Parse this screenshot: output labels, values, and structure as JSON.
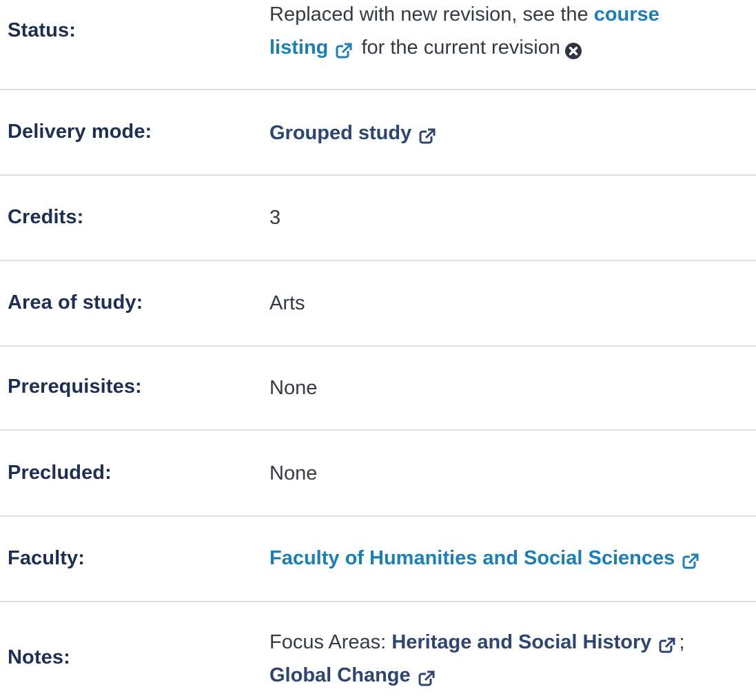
{
  "rows": {
    "status": {
      "label": "Status:",
      "text_before": "Replaced with new revision, see the",
      "link_line1": "course",
      "link_line2": "listing",
      "text_after": "for the current revision"
    },
    "delivery": {
      "label": "Delivery mode:",
      "link": "Grouped study"
    },
    "credits": {
      "label": "Credits:",
      "value": "3"
    },
    "area": {
      "label": "Area of study:",
      "value": "Arts"
    },
    "prereq": {
      "label": "Prerequisites:",
      "value": "None"
    },
    "precluded": {
      "label": "Precluded:",
      "value": "None"
    },
    "faculty": {
      "label": "Faculty:",
      "link": "Faculty of Humanities and Social Sciences"
    },
    "notes": {
      "label": "Notes:",
      "prefix": "Focus Areas:",
      "link1": "Heritage and Social History",
      "separator": ";",
      "link2": "Global Change"
    }
  },
  "colors": {
    "label": "#1e2f55",
    "link_blue": "#1a7fb6",
    "link_navy": "#2e4574",
    "divider": "#dcdfe4"
  },
  "icons": [
    "external-link-icon",
    "close-circle-icon"
  ]
}
